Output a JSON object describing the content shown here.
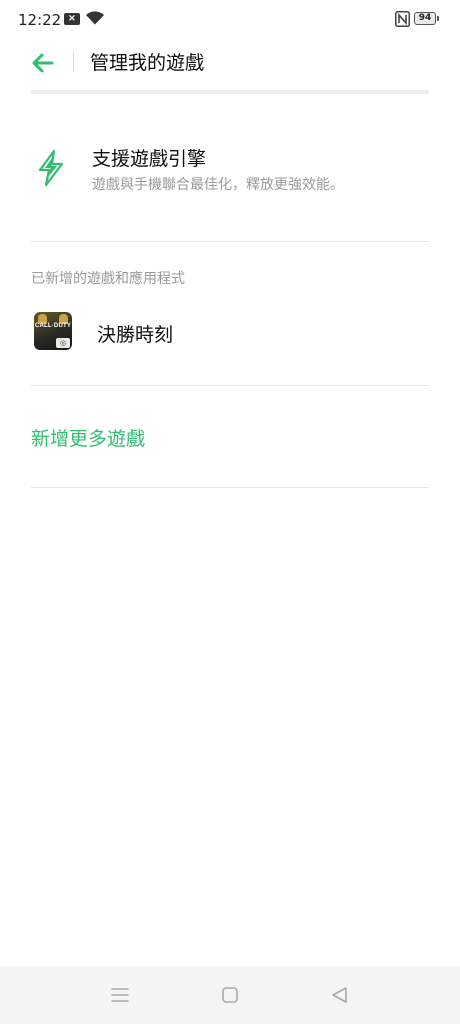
{
  "status_bar": {
    "time": "12:22",
    "notification_icon": "x-box-icon",
    "wifi_icon": "wifi-icon",
    "nfc_icon": "nfc-icon",
    "battery_level": "94"
  },
  "app_bar": {
    "back_icon": "arrow-left-icon",
    "title": "管理我的遊戲"
  },
  "engine": {
    "icon": "lightning-bolt-icon",
    "title": "支援遊戲引擎",
    "description": "遊戲與手機聯合最佳化，釋放更強效能。"
  },
  "section": {
    "header": "已新增的遊戲和應用程式"
  },
  "games": [
    {
      "name": "決勝時刻",
      "thumb_text": "CALL·DUTY"
    }
  ],
  "actions": {
    "add_more": "新增更多遊戲"
  },
  "colors": {
    "accent": "#2fbf71",
    "secondary_text": "#9a9a9a"
  },
  "nav_bar": {
    "icons": [
      "menu-icon",
      "home-square-icon",
      "back-triangle-icon"
    ]
  }
}
